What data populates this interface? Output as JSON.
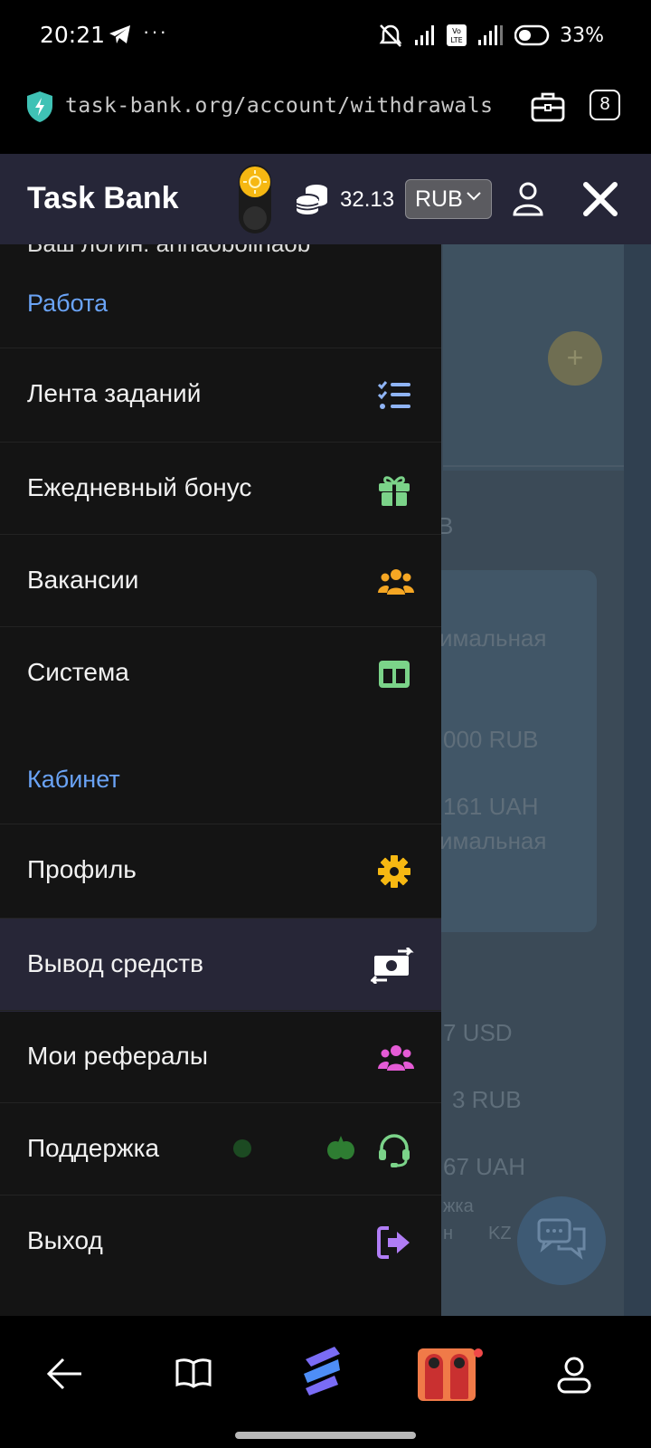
{
  "status_bar": {
    "time": "20:21",
    "dots": "···",
    "battery": "33%"
  },
  "browser": {
    "url": "task-bank.org/account/withdrawals",
    "tab_count": "8"
  },
  "header": {
    "brand": "Task Bank",
    "balance": "32.13",
    "currency": "RUB",
    "accent": "#f6b812"
  },
  "drawer": {
    "login_partial": "Ваш логин: annaobolinaob",
    "sections": [
      {
        "title": "Работа",
        "items": [
          {
            "label": "Лента заданий",
            "icon": "task-list-icon",
            "color": "#8fb4f5"
          },
          {
            "label": "Ежедневный бонус",
            "icon": "gift-icon",
            "color": "#7bd389"
          },
          {
            "label": "Вакансии",
            "icon": "users-icon",
            "color": "#f5a623"
          },
          {
            "label": "Система",
            "icon": "columns-icon",
            "color": "#7bd389"
          }
        ]
      },
      {
        "title": "Кабинет",
        "items": [
          {
            "label": "Профиль",
            "icon": "gear-icon",
            "color": "#f6b812"
          },
          {
            "label": "Вывод средств",
            "icon": "money-exchange-icon",
            "color": "#ffffff",
            "active": true
          },
          {
            "label": "Мои рефералы",
            "icon": "users-icon",
            "color": "#e55bd6"
          },
          {
            "label": "Поддержка",
            "icon": "headset-icon",
            "color": "#7bd389"
          },
          {
            "label": "Выход",
            "icon": "logout-icon",
            "color": "#b07df5"
          }
        ]
      }
    ]
  },
  "background_page": {
    "texts": [
      "В",
      "имальная",
      "000 RUB",
      "161 UAH",
      "имальная",
      "7 USD",
      "3 RUB",
      "67 UAH",
      "жка",
      "н",
      "KZ"
    ]
  },
  "bottom_nav": {
    "items": [
      "back-arrow-icon",
      "book-icon",
      "app-logo-icon",
      "game-thumbnail-icon",
      "profile-icon"
    ]
  }
}
